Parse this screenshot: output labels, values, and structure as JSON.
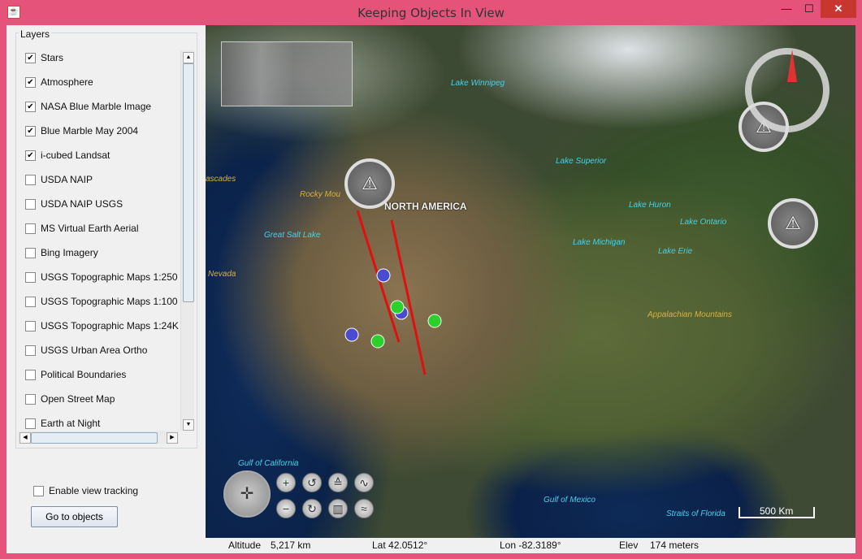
{
  "window": {
    "title": "Keeping Objects In View",
    "app_icon": "java-cup-icon",
    "controls": {
      "minimize": "—",
      "maximize": "☐",
      "close": "✕"
    },
    "frame_color": "#e5537a"
  },
  "layers": {
    "title": "Layers",
    "items": [
      {
        "label": "Stars",
        "checked": true
      },
      {
        "label": "Atmosphere",
        "checked": true
      },
      {
        "label": "NASA Blue Marble Image",
        "checked": true
      },
      {
        "label": "Blue Marble May 2004",
        "checked": true
      },
      {
        "label": "i-cubed Landsat",
        "checked": true
      },
      {
        "label": "USDA NAIP",
        "checked": false
      },
      {
        "label": "USDA NAIP USGS",
        "checked": false
      },
      {
        "label": "MS Virtual Earth Aerial",
        "checked": false
      },
      {
        "label": "Bing Imagery",
        "checked": false
      },
      {
        "label": "USGS Topographic Maps 1:250",
        "checked": false
      },
      {
        "label": "USGS Topographic Maps 1:100",
        "checked": false
      },
      {
        "label": "USGS Topographic Maps 1:24K",
        "checked": false
      },
      {
        "label": "USGS Urban Area Ortho",
        "checked": false
      },
      {
        "label": "Political Boundaries",
        "checked": false
      },
      {
        "label": "Open Street Map",
        "checked": false
      },
      {
        "label": "Earth at Night",
        "checked": false
      }
    ]
  },
  "controls": {
    "tracking_label": "Enable view tracking",
    "tracking_checked": false,
    "goto_button": "Go to objects"
  },
  "map": {
    "continent_label": "NORTH AMERICA",
    "water_labels": [
      "Lake Winnipeg",
      "Lake Superior",
      "Lake Huron",
      "Lake Ontario",
      "Lake Michigan",
      "Lake Erie",
      "Great Salt Lake",
      "Gulf of California",
      "Gulf of Mexico",
      "Straits of Florida"
    ],
    "land_labels": [
      "ascades",
      "Rocky Mou",
      "Nevada",
      "Appalachian Mountains"
    ],
    "scale": "500 Km",
    "icons": {
      "tower": "radio-tower-icon",
      "compass": "compass-icon",
      "pan": "pan-arrows-icon"
    }
  },
  "status": {
    "altitude_label": "Altitude",
    "altitude_value": "5,217 km",
    "lat": "Lat 42.0512°",
    "lon": "Lon -82.3189°",
    "elev_label": "Elev",
    "elev_value": "174 meters"
  }
}
